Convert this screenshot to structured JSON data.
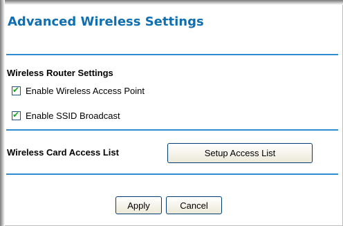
{
  "page": {
    "title": "Advanced Wireless Settings"
  },
  "router_settings": {
    "heading": "Wireless Router Settings",
    "options": [
      {
        "label": "Enable Wireless Access Point",
        "checked": true
      },
      {
        "label": "Enable SSID Broadcast",
        "checked": true
      }
    ]
  },
  "access_list": {
    "label": "Wireless Card Access List",
    "button_label": "Setup Access List"
  },
  "actions": {
    "apply_label": "Apply",
    "cancel_label": "Cancel"
  },
  "colors": {
    "title": "#0f6fb0",
    "rule": "#2f8ad0",
    "checkmark": "#21a121"
  }
}
